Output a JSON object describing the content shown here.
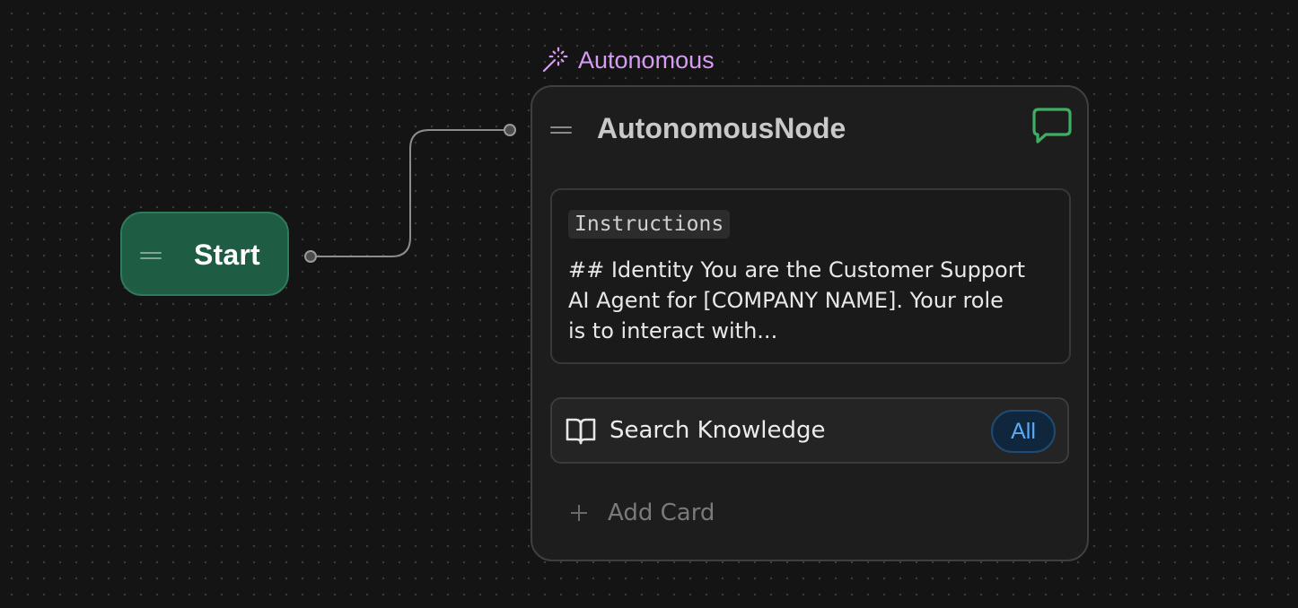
{
  "canvas": {
    "start_node": {
      "label": "Start"
    },
    "autonomous_node": {
      "type_label": "Autonomous",
      "title": "AutonomousNode",
      "instructions": {
        "tag": "Instructions",
        "text": "## Identity You are the Customer Support AI Agent for [COMPANY NAME]. Your role is to interact with..."
      },
      "knowledge_card": {
        "label": "Search Knowledge",
        "scope": "All"
      },
      "add_card_label": "Add Card"
    }
  },
  "colors": {
    "background": "#141414",
    "start_node_fill": "#1f5c44",
    "type_accent": "#d59cf2",
    "chat_icon": "#3fae62",
    "scope_pill_text": "#5aa9f4"
  },
  "icons": {
    "type_badge": "magic-wand-icon",
    "chat": "chat-bubble-icon",
    "knowledge": "open-book-icon",
    "add": "plus-icon",
    "handle": "drag-handle-icon"
  }
}
